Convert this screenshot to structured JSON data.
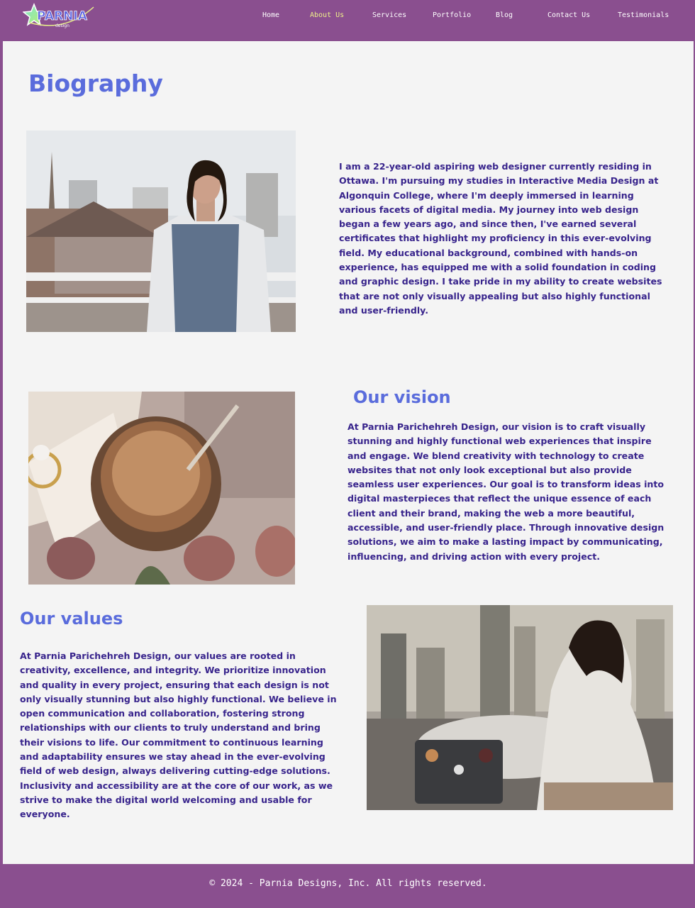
{
  "brand": {
    "logo_text": "PARNIA",
    "logo_subtext": "design"
  },
  "nav": {
    "items": [
      {
        "label": "Home"
      },
      {
        "label": "About Us"
      },
      {
        "label": "Services"
      },
      {
        "label": "Portfolio"
      },
      {
        "label": "Blog"
      },
      {
        "label": "Contact Us"
      },
      {
        "label": "Testimonials"
      }
    ],
    "active_index": 1
  },
  "biography": {
    "title": "Biography",
    "text": "I am a 22-year-old aspiring web designer currently residing in Ottawa. I'm pursuing my studies in Interactive Media Design at Algonquin College, where I'm deeply immersed in learning various facets of digital media. My journey into web design began a few years ago, and since then, I've earned several certificates that highlight my proficiency in this ever-evolving field. My educational background, combined with hands-on experience, has equipped me with a solid foundation in coding and graphic design. I take pride in my ability to create websites that are not only visually appealing but also highly functional and user-friendly."
  },
  "vision": {
    "title": "Our vision",
    "text": "At Parnia Parichehreh Design, our vision is to craft visually stunning and highly functional web experiences that inspire and engage. We blend creativity with technology to create websites that not only look exceptional but also provide seamless user experiences. Our goal is to transform ideas into digital masterpieces that reflect the unique essence of each client and their brand, making the web a more beautiful, accessible, and user-friendly place. Through innovative design solutions, we aim to make a lasting impact by communicating, influencing, and driving action with every project."
  },
  "values": {
    "title": "Our values",
    "text": "At Parnia Parichehreh Design, our values are rooted in creativity, excellence, and integrity. We prioritize innovation and quality in every project, ensuring that each design is not only visually stunning but also highly functional. We believe in open communication and collaboration, fostering strong relationships with our clients to truly understand and bring their visions to life. Our commitment to continuous learning and adaptability ensures we stay ahead in the ever-evolving field of web design, always delivering cutting-edge solutions. Inclusivity and accessibility are at the core of our work, as we strive to make the digital world welcoming and usable for everyone."
  },
  "footer": {
    "text": "© 2024 - Parnia Designs, Inc. All rights reserved."
  },
  "colors": {
    "brand_purple": "#8a4f8f",
    "heading_blue": "#5a6cdc",
    "body_text": "#38248c",
    "active_nav": "#eef08a",
    "page_bg": "#f4f4f4"
  }
}
